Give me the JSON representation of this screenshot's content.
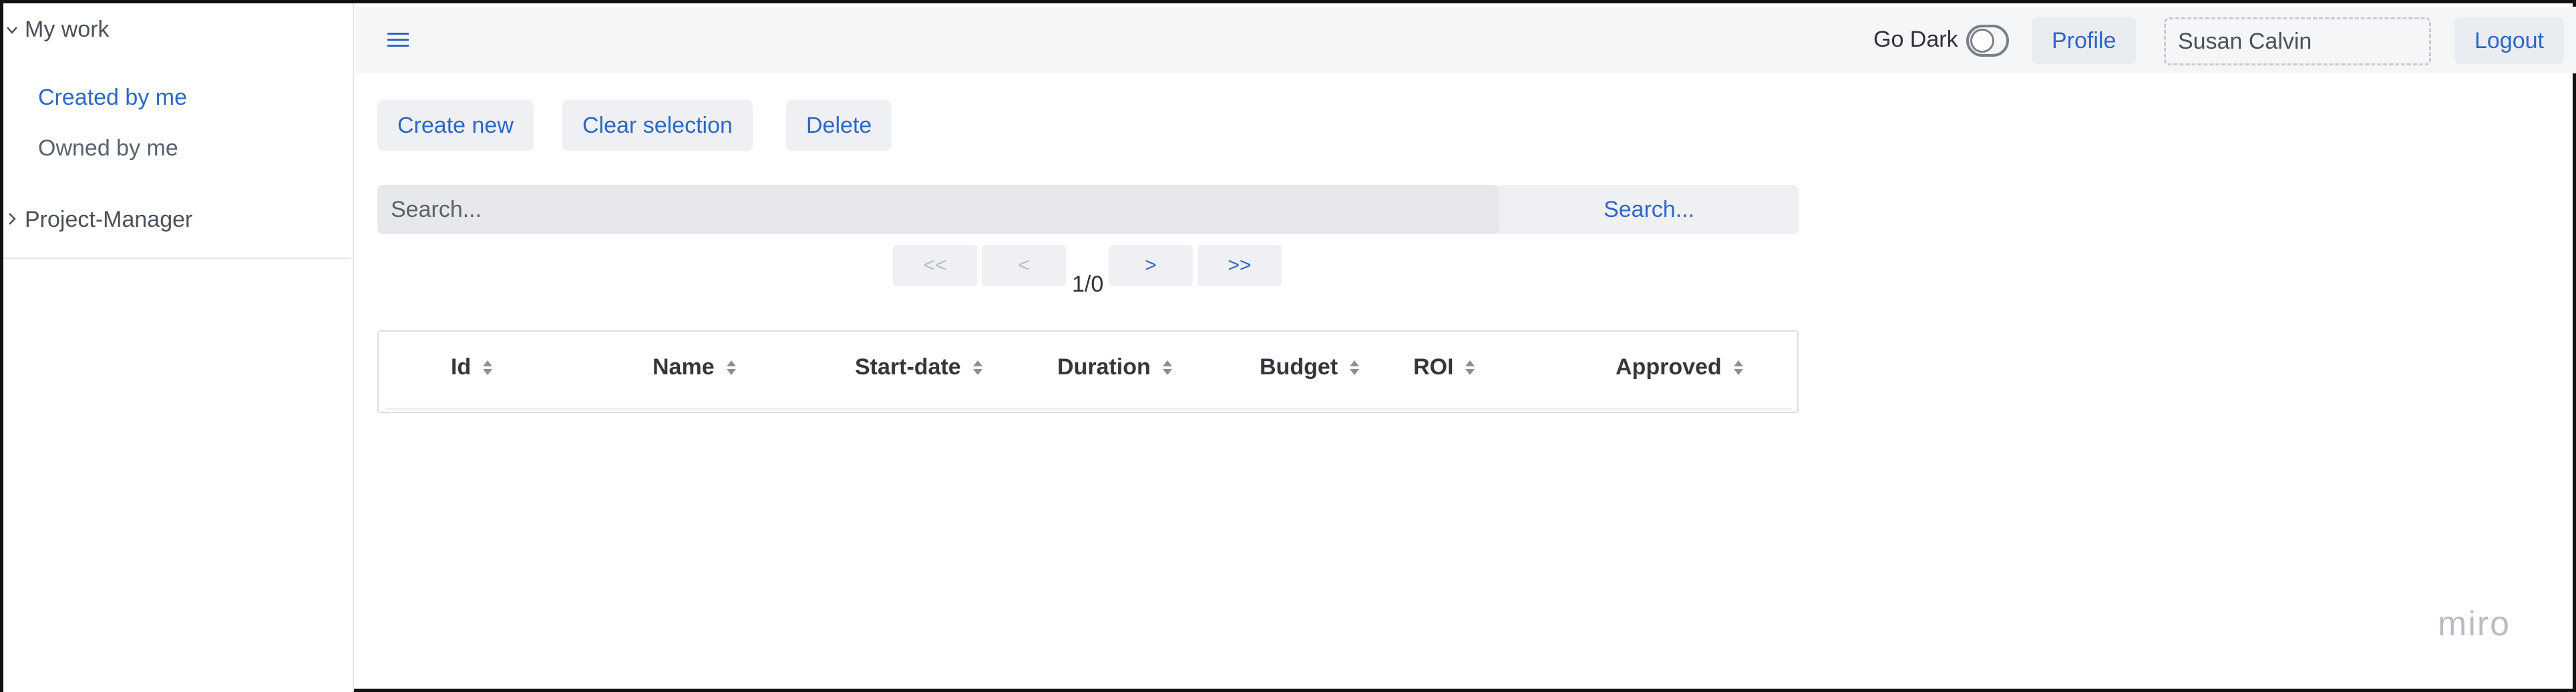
{
  "sidebar": {
    "groups": [
      {
        "label": "My work",
        "expanded": true,
        "items": [
          {
            "label": "Created by me",
            "active": true
          },
          {
            "label": "Owned by me",
            "active": false
          }
        ]
      },
      {
        "label": "Project-Manager",
        "expanded": false,
        "items": []
      }
    ]
  },
  "header": {
    "menu_icon": "hamburger-icon",
    "go_dark_label": "Go Dark",
    "go_dark_on": false,
    "profile_label": "Profile",
    "user_value": "Susan Calvin",
    "logout_label": "Logout"
  },
  "actions": {
    "create_label": "Create new",
    "clear_label": "Clear selection",
    "delete_label": "Delete"
  },
  "search": {
    "placeholder": "Search...",
    "button_label": "Search..."
  },
  "pagination": {
    "first": "<<",
    "prev": "<",
    "next": ">",
    "last": ">>",
    "indicator": "1/0"
  },
  "table": {
    "columns": [
      "Id",
      "Name",
      "Start-date",
      "Duration",
      "Budget",
      "ROI",
      "Approved"
    ],
    "rows": []
  },
  "watermark": "miro",
  "colors": {
    "accent": "#2d67c6",
    "header_bg": "#f5f6f8",
    "button_bg": "#eef0f3"
  }
}
